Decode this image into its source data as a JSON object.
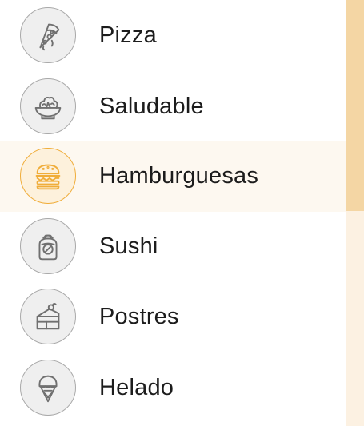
{
  "categories": {
    "items": [
      {
        "label": "Pizza",
        "icon": "pizza-icon",
        "selected": false
      },
      {
        "label": "Saludable",
        "icon": "salad-bowl-icon",
        "selected": false
      },
      {
        "label": "Hamburguesas",
        "icon": "burger-icon",
        "selected": true
      },
      {
        "label": "Sushi",
        "icon": "sushi-icon",
        "selected": false
      },
      {
        "label": "Postres",
        "icon": "cake-icon",
        "selected": false
      },
      {
        "label": "Helado",
        "icon": "ice-cream-icon",
        "selected": false
      }
    ]
  },
  "colors": {
    "accent": "#f0ad3a",
    "selected_row_background": "#fdf8f0",
    "icon_stroke": "#707070",
    "icon_circle_background": "#efefef",
    "scrollbar_track": "#fcf1e2",
    "scrollbar_thumb": "#f4d6a4"
  }
}
